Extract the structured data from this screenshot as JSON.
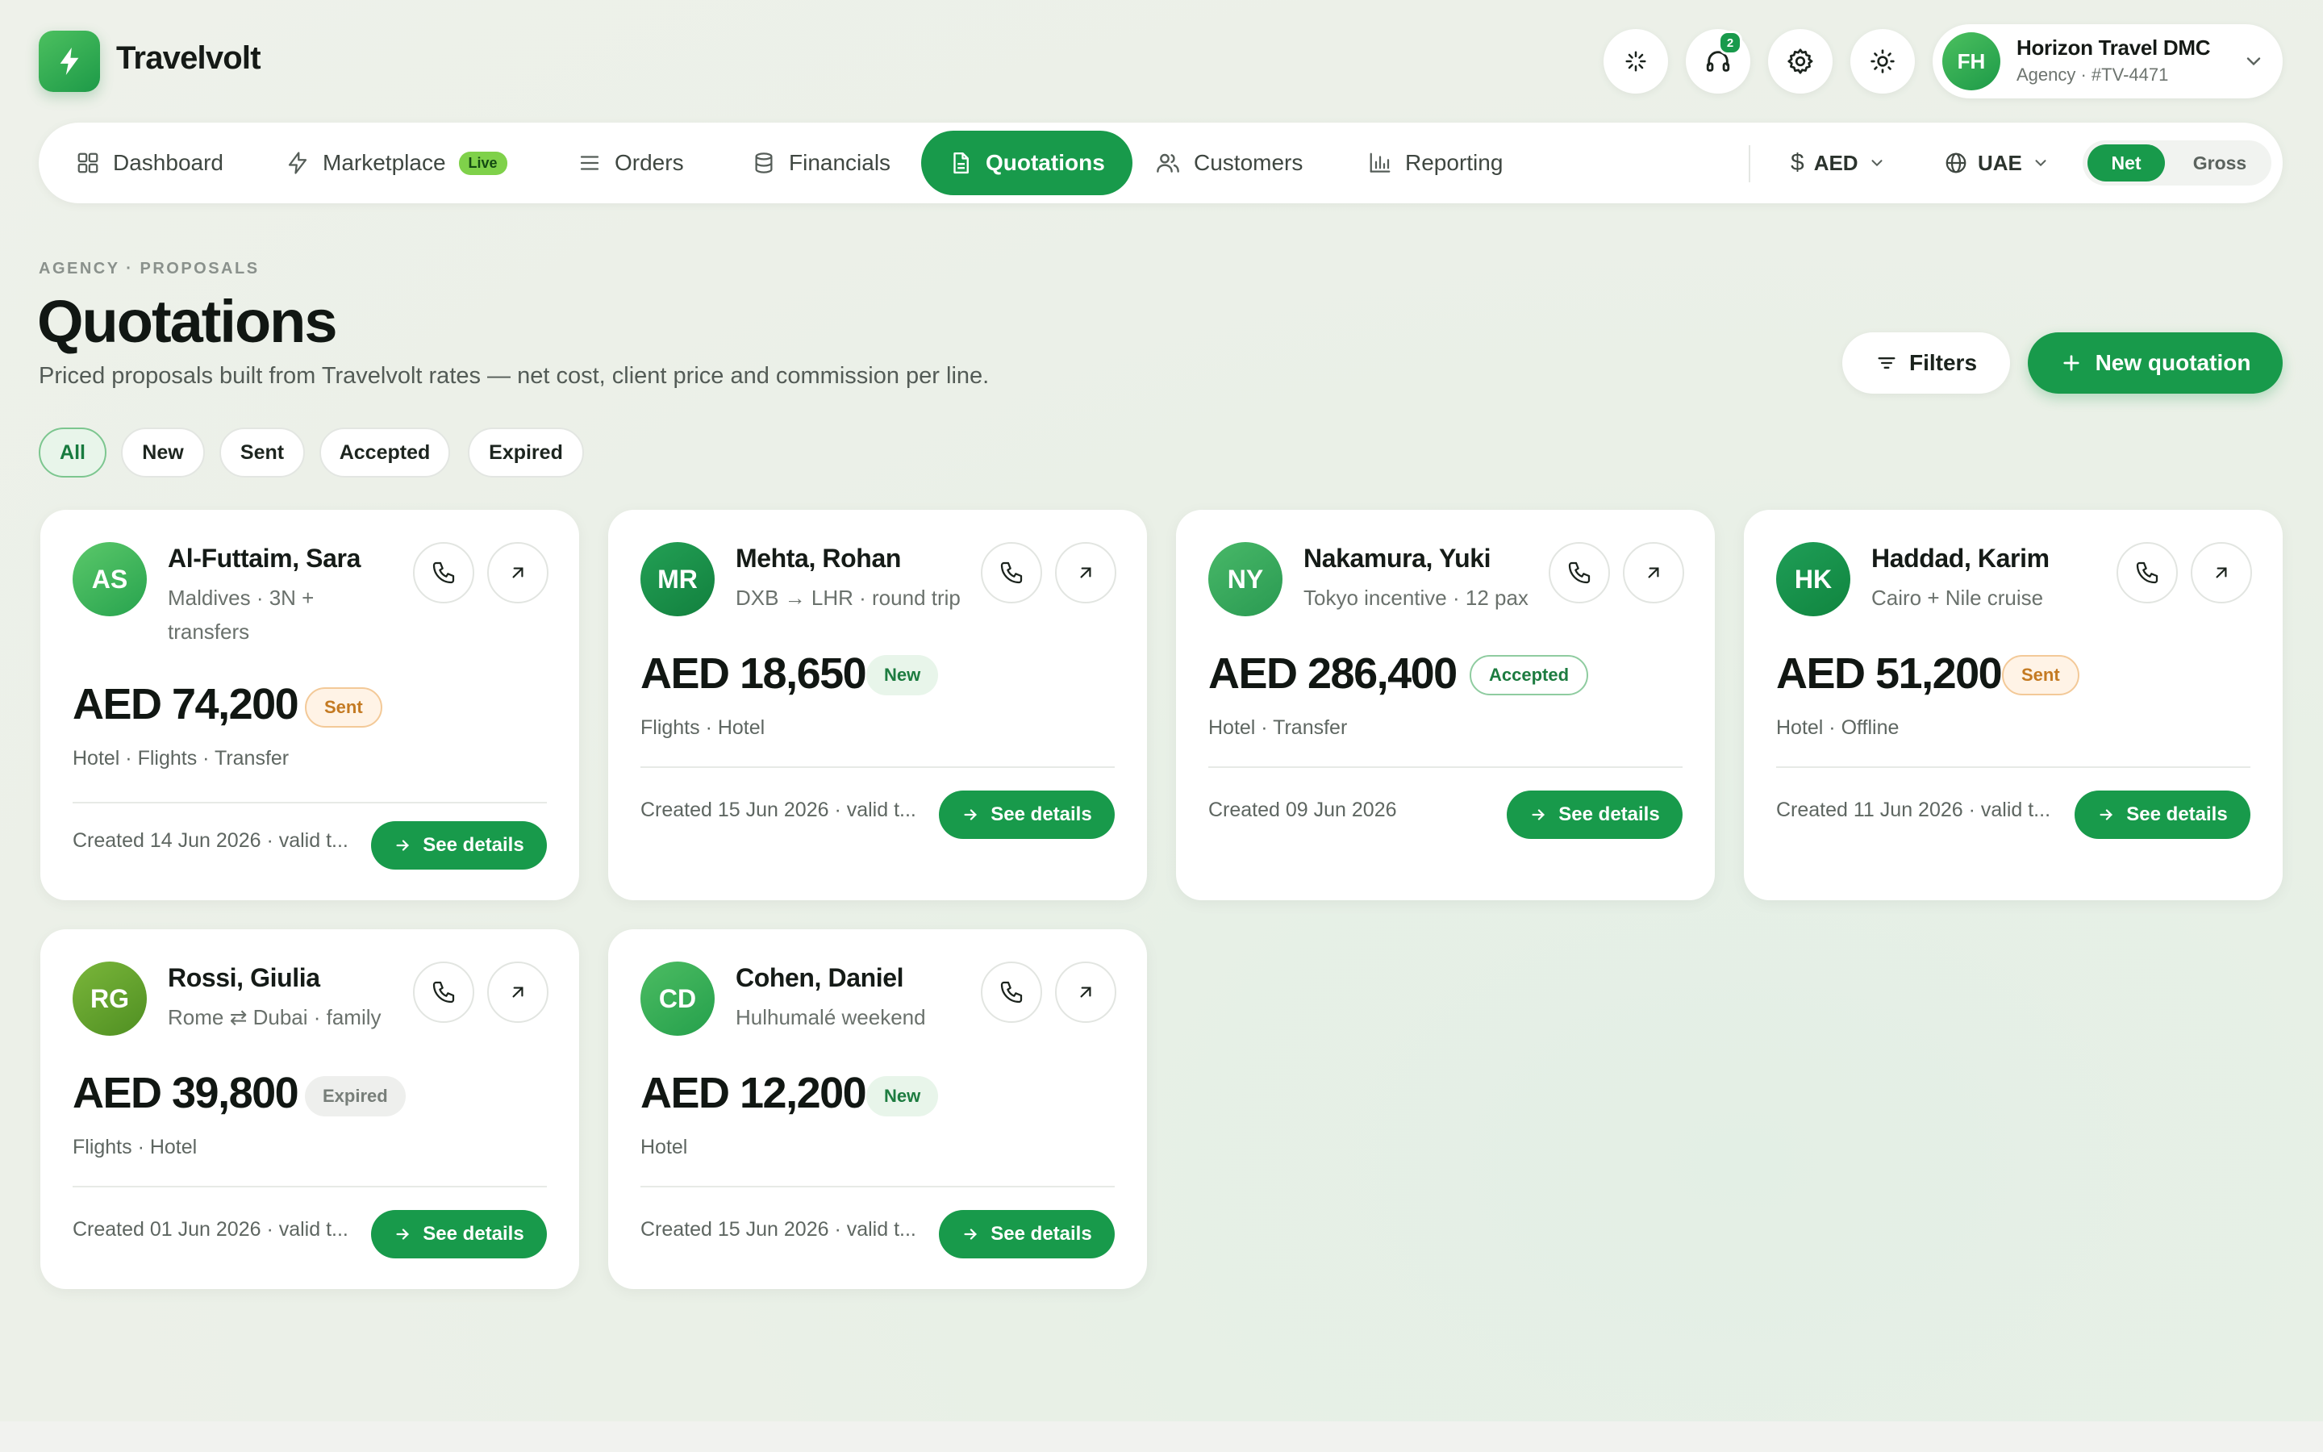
{
  "app": {
    "name": "Travelvolt"
  },
  "header": {
    "notifications_count": "2",
    "account": {
      "initials": "FH",
      "name": "Horizon Travel DMC",
      "subtitle": "Agency · #TV-4471"
    }
  },
  "nav": {
    "items": [
      {
        "label": "Dashboard",
        "icon": "grid-icon"
      },
      {
        "label": "Marketplace",
        "icon": "bolt-icon",
        "badge": "Live"
      },
      {
        "label": "Orders",
        "icon": "list-icon"
      },
      {
        "label": "Financials",
        "icon": "database-icon"
      },
      {
        "label": "Quotations",
        "icon": "document-icon",
        "active": true
      },
      {
        "label": "Customers",
        "icon": "users-icon"
      },
      {
        "label": "Reporting",
        "icon": "bar-chart-icon"
      }
    ],
    "currency": "AED",
    "region": "UAE",
    "pricing_toggle": {
      "options": [
        "Net",
        "Gross"
      ],
      "selected": "Net"
    }
  },
  "page": {
    "eyebrow": "AGENCY · PROPOSALS",
    "title": "Quotations",
    "subtitle": "Priced proposals built from Travelvolt rates — net cost, client price and commission per line.",
    "filters_label": "Filters",
    "new_label": "New quotation"
  },
  "status_filters": {
    "options": [
      "All",
      "New",
      "Sent",
      "Accepted",
      "Expired"
    ],
    "selected": "All"
  },
  "quotations": [
    {
      "initials": "AS",
      "name": "Al-Futtaim, Sara",
      "subtitle": "Maldives · 3N + transfers",
      "price": "AED 74,200",
      "status": "Sent",
      "items": "Hotel · Flights · Transfer",
      "created": "Created 14 Jun 2026 · valid t...",
      "action": "See details"
    },
    {
      "initials": "MR",
      "name": "Mehta, Rohan",
      "subtitle": "DXB → LHR · round trip",
      "price": "AED 18,650",
      "status": "New",
      "items": "Flights · Hotel",
      "created": "Created 15 Jun 2026 · valid t...",
      "action": "See details"
    },
    {
      "initials": "NY",
      "name": "Nakamura, Yuki",
      "subtitle": "Tokyo incentive · 12 pax",
      "price": "AED 286,400",
      "status": "Accepted",
      "items": "Hotel · Transfer",
      "created": "Created 09 Jun 2026",
      "action": "See details"
    },
    {
      "initials": "HK",
      "name": "Haddad, Karim",
      "subtitle": "Cairo + Nile cruise",
      "price": "AED 51,200",
      "status": "Sent",
      "items": "Hotel · Offline",
      "created": "Created 11 Jun 2026 · valid t...",
      "action": "See details"
    },
    {
      "initials": "RG",
      "name": "Rossi, Giulia",
      "subtitle": "Rome ⇄ Dubai · family",
      "price": "AED 39,800",
      "status": "Expired",
      "items": "Flights · Hotel",
      "created": "Created 01 Jun 2026 · valid t...",
      "action": "See details"
    },
    {
      "initials": "CD",
      "name": "Cohen, Daniel",
      "subtitle": "Hulhumalé weekend",
      "price": "AED 12,200",
      "status": "New",
      "items": "Hotel",
      "created": "Created 15 Jun 2026 · valid t...",
      "action": "See details"
    }
  ],
  "colors": {
    "brand": "#189a4b",
    "background": "#eef1ea",
    "card": "#ffffff",
    "sent": "#c47a22",
    "expired": "#777e79"
  }
}
